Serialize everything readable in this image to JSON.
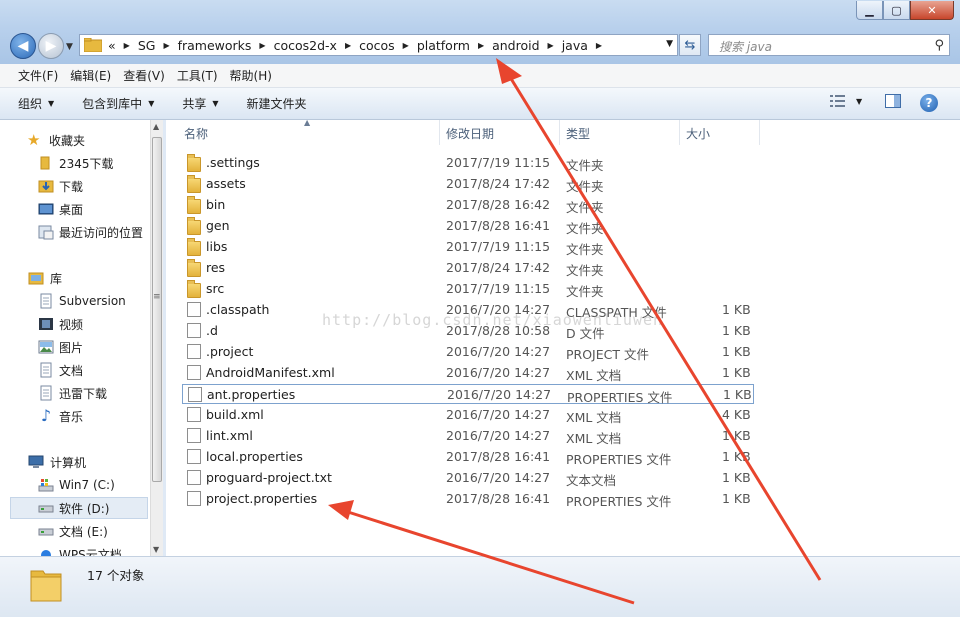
{
  "address": {
    "overflow": "«",
    "crumbs": [
      "SG",
      "frameworks",
      "cocos2d-x",
      "cocos",
      "platform",
      "android",
      "java"
    ]
  },
  "search": {
    "placeholder": "搜索 java"
  },
  "menu": [
    "文件(F)",
    "编辑(E)",
    "查看(V)",
    "工具(T)",
    "帮助(H)"
  ],
  "toolbar": {
    "organize": "组织",
    "include_library": "包含到库中",
    "share": "共享",
    "new_folder": "新建文件夹"
  },
  "sidebar": {
    "favorites": {
      "label": "收藏夹",
      "items": [
        "2345下载",
        "下载",
        "桌面",
        "最近访问的位置"
      ]
    },
    "libraries": {
      "label": "库",
      "items": [
        "Subversion",
        "视频",
        "图片",
        "文档",
        "迅雷下载",
        "音乐"
      ]
    },
    "computer": {
      "label": "计算机",
      "items": [
        "Win7 (C:)",
        "软件 (D:)",
        "文档 (E:)",
        "WPS云文档"
      ]
    }
  },
  "columns": {
    "name": "名称",
    "date": "修改日期",
    "type": "类型",
    "size": "大小"
  },
  "files": [
    {
      "name": ".settings",
      "date": "2017/7/19 11:15",
      "type": "文件夹",
      "size": "",
      "kind": "folder"
    },
    {
      "name": "assets",
      "date": "2017/8/24 17:42",
      "type": "文件夹",
      "size": "",
      "kind": "folder"
    },
    {
      "name": "bin",
      "date": "2017/8/28 16:42",
      "type": "文件夹",
      "size": "",
      "kind": "folder"
    },
    {
      "name": "gen",
      "date": "2017/8/28 16:41",
      "type": "文件夹",
      "size": "",
      "kind": "folder"
    },
    {
      "name": "libs",
      "date": "2017/7/19 11:15",
      "type": "文件夹",
      "size": "",
      "kind": "folder"
    },
    {
      "name": "res",
      "date": "2017/8/24 17:42",
      "type": "文件夹",
      "size": "",
      "kind": "folder"
    },
    {
      "name": "src",
      "date": "2017/7/19 11:15",
      "type": "文件夹",
      "size": "",
      "kind": "folder"
    },
    {
      "name": ".classpath",
      "date": "2016/7/20 14:27",
      "type": "CLASSPATH 文件",
      "size": "1 KB",
      "kind": "file"
    },
    {
      "name": ".d",
      "date": "2017/8/28 10:58",
      "type": "D 文件",
      "size": "1 KB",
      "kind": "file"
    },
    {
      "name": ".project",
      "date": "2016/7/20 14:27",
      "type": "PROJECT 文件",
      "size": "1 KB",
      "kind": "file"
    },
    {
      "name": "AndroidManifest.xml",
      "date": "2016/7/20 14:27",
      "type": "XML 文档",
      "size": "1 KB",
      "kind": "file"
    },
    {
      "name": "ant.properties",
      "date": "2016/7/20 14:27",
      "type": "PROPERTIES 文件",
      "size": "1 KB",
      "kind": "file",
      "selected": true
    },
    {
      "name": "build.xml",
      "date": "2016/7/20 14:27",
      "type": "XML 文档",
      "size": "4 KB",
      "kind": "file"
    },
    {
      "name": "lint.xml",
      "date": "2016/7/20 14:27",
      "type": "XML 文档",
      "size": "1 KB",
      "kind": "file"
    },
    {
      "name": "local.properties",
      "date": "2017/8/28 16:41",
      "type": "PROPERTIES 文件",
      "size": "1 KB",
      "kind": "file"
    },
    {
      "name": "proguard-project.txt",
      "date": "2016/7/20 14:27",
      "type": "文本文档",
      "size": "1 KB",
      "kind": "file"
    },
    {
      "name": "project.properties",
      "date": "2017/8/28 16:41",
      "type": "PROPERTIES 文件",
      "size": "1 KB",
      "kind": "file"
    }
  ],
  "watermark": "http://blog.csdn.net/xiaowenliuwen",
  "status": {
    "count": "17 个对象"
  },
  "colors": {
    "annotation_red": "#e8452e",
    "selection_border": "#7da2ce"
  }
}
